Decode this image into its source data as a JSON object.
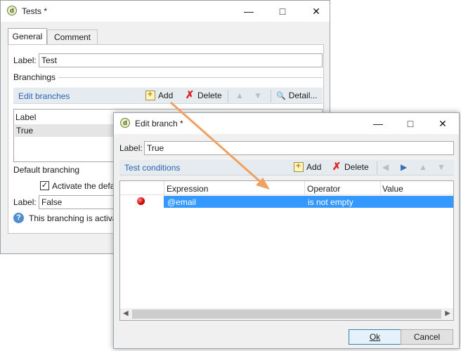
{
  "back_window": {
    "title": "Tests *",
    "tabs": [
      "General",
      "Comment"
    ],
    "label_caption": "Label:",
    "label_value": "Test",
    "branchings_heading": "Branchings",
    "edit_branches_link": "Edit branches",
    "add_label": "Add",
    "delete_label": "Delete",
    "detail_label": "Detail...",
    "list_header": "Label",
    "list_rows": [
      "True"
    ],
    "default_branching_heading": "Default branching",
    "activate_label": "Activate the defa",
    "default_label_caption": "Label:",
    "default_label_value": "False",
    "info_text": "This branching is activa"
  },
  "front_window": {
    "title": "Edit branch *",
    "label_caption": "Label:",
    "label_value": "True",
    "test_conditions_link": "Test conditions",
    "add_label": "Add",
    "delete_label": "Delete",
    "columns": [
      "Expression",
      "Operator",
      "Value"
    ],
    "rows": [
      {
        "expression": "@email",
        "operator": "is not empty",
        "value": ""
      }
    ],
    "ok_label": "Ok",
    "cancel_label": "Cancel"
  },
  "colors": {
    "selection": "#3399ff",
    "link": "#2a64b2",
    "annotation_arrow": "#f0a060",
    "status_dot": "#cc0000"
  }
}
